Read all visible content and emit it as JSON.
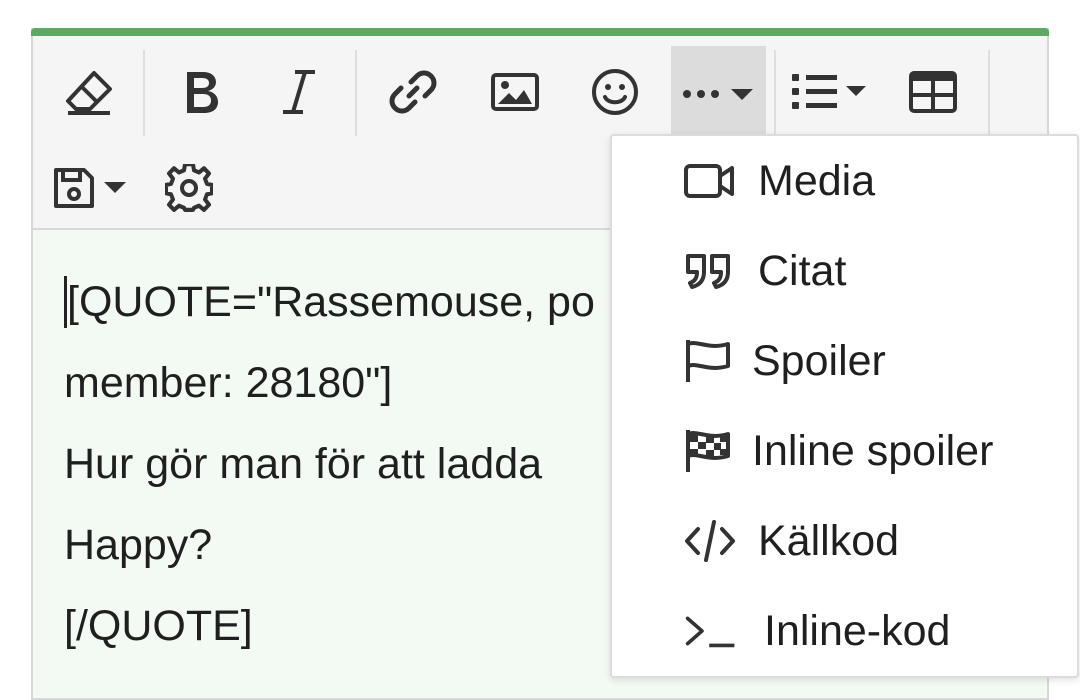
{
  "colors": {
    "accent": "#5fa864",
    "toolbar_bg": "#f5f5f5",
    "content_bg": "#f3f9f3",
    "active_button_bg": "#dcdcdc",
    "text": "#1f1f1f",
    "icon": "#333333"
  },
  "toolbar": {
    "buttons": [
      {
        "name": "clear-formatting",
        "icon": "eraser-icon"
      },
      {
        "name": "bold",
        "icon": "bold-icon"
      },
      {
        "name": "italic",
        "icon": "italic-icon"
      },
      {
        "name": "insert-link",
        "icon": "link-icon"
      },
      {
        "name": "insert-image",
        "icon": "image-icon"
      },
      {
        "name": "smilies",
        "icon": "smiley-icon"
      },
      {
        "name": "more-options",
        "icon": "ellipsis-dropdown-icon",
        "active": true
      },
      {
        "name": "list",
        "icon": "list-dropdown-icon"
      },
      {
        "name": "insert-table",
        "icon": "table-icon"
      },
      {
        "name": "drafts",
        "icon": "save-dropdown-icon"
      },
      {
        "name": "settings",
        "icon": "gear-icon"
      }
    ]
  },
  "content": {
    "lines": [
      "[QUOTE=\"Rassemouse, po",
      "member: 28180\"]",
      "Hur gör man för att ladda",
      "Happy?",
      "[/QUOTE]"
    ]
  },
  "dropdown": {
    "items": [
      {
        "label": "Media",
        "icon": "video-camera-icon"
      },
      {
        "label": "Citat",
        "icon": "quote-icon"
      },
      {
        "label": "Spoiler",
        "icon": "flag-icon"
      },
      {
        "label": "Inline spoiler",
        "icon": "checkered-flag-icon"
      },
      {
        "label": "Källkod",
        "icon": "code-icon"
      },
      {
        "label": "Inline-kod",
        "icon": "terminal-icon"
      }
    ]
  }
}
